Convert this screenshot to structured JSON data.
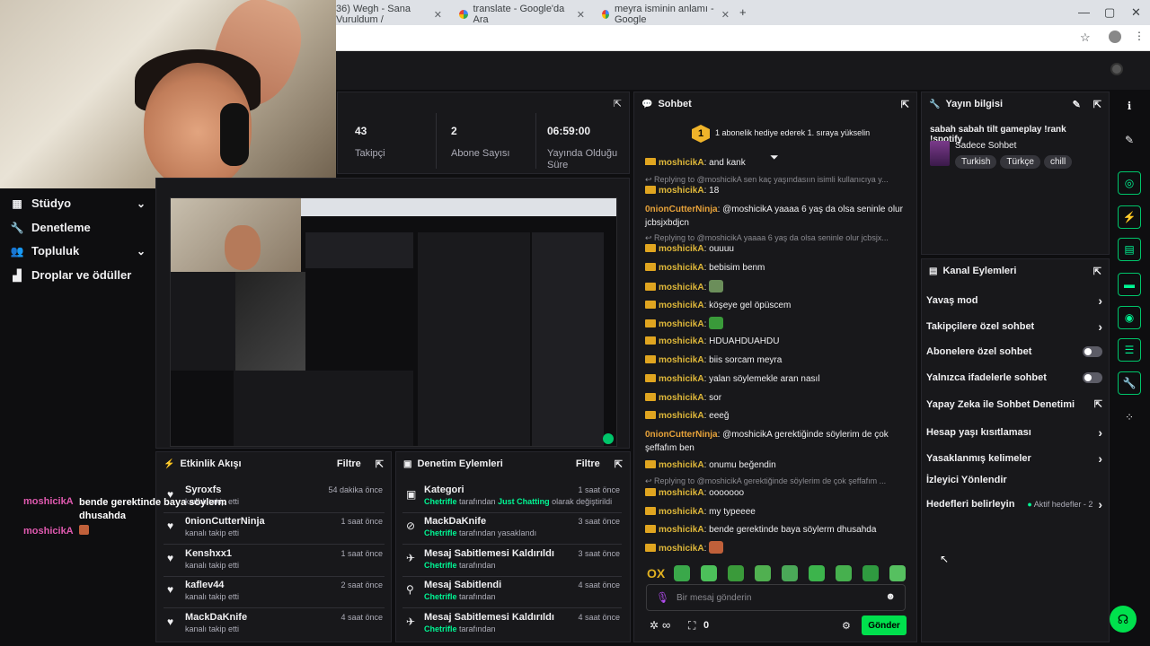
{
  "browser": {
    "tabs": [
      {
        "title": "36) Wegh - Sana Vuruldum /"
      },
      {
        "title": "translate - Google'da Ara"
      },
      {
        "title": "meyra isminin anlamı - Google"
      }
    ],
    "new_tab": "+",
    "window_controls": [
      "—",
      "▢",
      "✕"
    ]
  },
  "sidebar": {
    "items": [
      {
        "label": "Stüdyo",
        "icon": "studio-icon",
        "expandable": true
      },
      {
        "label": "Denetleme",
        "icon": "wrench-icon",
        "expandable": false
      },
      {
        "label": "Topluluk",
        "icon": "community-icon",
        "expandable": true
      },
      {
        "label": "Droplar ve ödüller",
        "icon": "drops-icon",
        "expandable": false
      }
    ]
  },
  "stats": [
    {
      "value": "43",
      "label": "Takipçi"
    },
    {
      "value": "2",
      "label": "Abone Sayısı"
    },
    {
      "value": "06:59:00",
      "label": "Yayında Olduğu Süre"
    }
  ],
  "activity": {
    "title": "Etkinlik Akışı",
    "filter": "Filtre",
    "rows": [
      {
        "name": "Syroxfs",
        "sub": "kanalı takip etti",
        "time": "54 dakika önce"
      },
      {
        "name": "0nionCutterNinja",
        "sub": "kanalı takip etti",
        "time": "1 saat önce"
      },
      {
        "name": "Kenshxx1",
        "sub": "kanalı takip etti",
        "time": "1 saat önce"
      },
      {
        "name": "kaflev44",
        "sub": "kanalı takip etti",
        "time": "2 saat önce"
      },
      {
        "name": "MackDaKnife",
        "sub": "kanalı takip etti",
        "time": "4 saat önce"
      }
    ]
  },
  "moderation": {
    "title": "Denetim Eylemleri",
    "filter": "Filtre",
    "rows": [
      {
        "name": "Kategori",
        "actor": "Chetrifle",
        "mid": " tarafından ",
        "hl": "Just Chatting",
        "end": " olarak değiştirildi",
        "time": "1 saat önce"
      },
      {
        "name": "MackDaKnife",
        "actor": "Chetrifle",
        "mid": " tarafından yasaklandı",
        "hl": "",
        "end": "",
        "time": "3 saat önce"
      },
      {
        "name": "Mesaj Sabitlemesi Kaldırıldı",
        "actor": "Chetrifle",
        "mid": " tarafından",
        "hl": "",
        "end": "",
        "time": "3 saat önce"
      },
      {
        "name": "Mesaj Sabitlendi",
        "actor": "Chetrifle",
        "mid": " tarafından",
        "hl": "",
        "end": "",
        "time": "4 saat önce"
      },
      {
        "name": "Mesaj Sabitlemesi Kaldırıldı",
        "actor": "Chetrifle",
        "mid": " tarafından",
        "hl": "",
        "end": "",
        "time": "4 saat önce"
      }
    ]
  },
  "chat": {
    "title": "Sohbet",
    "hype_rank": "1",
    "hype_text": "1 abonelik hediye ederek 1. sıraya yükselin",
    "lines": [
      {
        "type": "msg",
        "user": "moshicikA",
        "text": "and kank",
        "badge": true
      },
      {
        "type": "reply",
        "text": "Replying to @moshicikA sen kaç yaşındasıın isimli kullanıcıya y..."
      },
      {
        "type": "msg",
        "user": "moshicikA",
        "text": "18",
        "badge": true
      },
      {
        "type": "msg2",
        "user": "0nionCutterNinja",
        "text": "@moshicikA yaaaa 6 yaş da olsa seninle olur jcbsjxbdjcn",
        "badge": false
      },
      {
        "type": "reply",
        "text": "Replying to @moshicikA yaaaa 6 yaş da olsa seninle olur jcbsjx..."
      },
      {
        "type": "msg",
        "user": "moshicikA",
        "text": "ouuuu",
        "badge": true
      },
      {
        "type": "msg",
        "user": "moshicikA",
        "text": "bebisim benm",
        "badge": true
      },
      {
        "type": "msg",
        "user": "moshicikA",
        "text": "",
        "badge": true,
        "emote": "#6b8e5a"
      },
      {
        "type": "msg",
        "user": "moshicikA",
        "text": "köşeye gel öpüscem",
        "badge": true
      },
      {
        "type": "msg",
        "user": "moshicikA",
        "text": "",
        "badge": true,
        "emote": "#3a9a3a"
      },
      {
        "type": "msg",
        "user": "moshicikA",
        "text": "HDUAHDUAHDU",
        "badge": true
      },
      {
        "type": "msg",
        "user": "moshicikA",
        "text": "biis sorcam meyra",
        "badge": true
      },
      {
        "type": "msg",
        "user": "moshicikA",
        "text": "yalan söylemekle aran nasıl",
        "badge": true
      },
      {
        "type": "msg",
        "user": "moshicikA",
        "text": "sor",
        "badge": true
      },
      {
        "type": "msg",
        "user": "moshicikA",
        "text": "eeeğ",
        "badge": true
      },
      {
        "type": "msg2",
        "user": "0nionCutterNinja",
        "text": "@moshicikA gerektiğinde söylerim de çok şeffafım ben",
        "badge": false
      },
      {
        "type": "msg",
        "user": "moshicikA",
        "text": "onumu beğendin",
        "badge": true
      },
      {
        "type": "reply",
        "text": "Replying to @moshicikA gerektiğinde söylerim de çok şeffafım ..."
      },
      {
        "type": "msg",
        "user": "moshicikA",
        "text": "ooooooo",
        "badge": true
      },
      {
        "type": "msg",
        "user": "moshicikA",
        "text": "my typeeee",
        "badge": true
      },
      {
        "type": "msg",
        "user": "moshicikA",
        "text": "bende gerektinde baya söylerm dhusahda",
        "badge": true
      },
      {
        "type": "msg",
        "user": "moshicikA",
        "text": "",
        "badge": true,
        "emote": "#c0603a"
      }
    ],
    "input_placeholder": "Bir mesaj gönderin",
    "points": "∞",
    "vault_count": "0",
    "send_label": "Gönder",
    "emote_logo": "OX"
  },
  "stream_info": {
    "title_label": "Yayın bilgisi",
    "stream_title": "sabah sabah tilt gameplay !rank !spotify",
    "category": "Sadece Sohbet",
    "tags": [
      "Turkish",
      "Türkçe",
      "chill"
    ]
  },
  "channel_actions": {
    "title": "Kanal Eylemleri",
    "items": [
      {
        "label": "Yavaş mod",
        "control": "chevron"
      },
      {
        "label": "Takipçilere özel sohbet",
        "control": "chevron"
      },
      {
        "label": "Abonelere özel sohbet",
        "control": "toggle"
      },
      {
        "label": "Yalnızca ifadelerle sohbet",
        "control": "toggle"
      },
      {
        "label": "Yapay Zeka ile Sohbet Denetimi",
        "control": "external"
      },
      {
        "label": "Hesap yaşı kısıtlaması",
        "control": "chevron"
      },
      {
        "label": "Yasaklanmış kelimeler",
        "control": "chevron"
      },
      {
        "label": "İzleyici Yönlendir",
        "control": "none"
      },
      {
        "label": "Hedefleri belirleyin",
        "control": "goals",
        "extra": "Aktif hedefler - 2"
      }
    ]
  },
  "overlay_chat": {
    "user": "moshicikA",
    "message": "bende gerektinde baya söylerm dhusahda",
    "user2": "moshicikA"
  },
  "colors": {
    "accent_green": "#00f593",
    "send_button": "#00e04d",
    "badge_gold": "#e0a520",
    "panel_bg": "#18181b"
  }
}
